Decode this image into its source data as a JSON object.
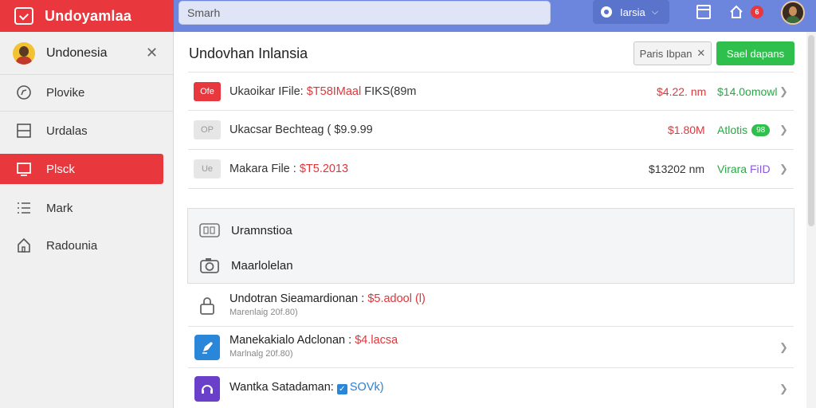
{
  "app": {
    "title": "Undoyamlaa"
  },
  "search": {
    "placeholder": "Smarh"
  },
  "topbar": {
    "user_label": "Iarsia",
    "notification_count": "6"
  },
  "colors": {
    "brand": "#e8383d",
    "topbar": "#6b86dc",
    "success": "#2fbf4c"
  },
  "sidebar": {
    "header": "Undonesia",
    "items": [
      {
        "label": "Plovike",
        "icon": "compass-icon",
        "active": false
      },
      {
        "label": "Urdalas",
        "icon": "layout-icon",
        "active": false
      },
      {
        "label": "Plsck",
        "icon": "monitor-icon",
        "active": true
      },
      {
        "label": "Mark",
        "icon": "list-icon",
        "active": false
      },
      {
        "label": "Radounia",
        "icon": "home-icon",
        "active": false
      }
    ]
  },
  "main": {
    "title": "Undovhan Inlansia",
    "filter_label": "Paris Ibpan",
    "primary_label": "Sael dapans"
  },
  "rows": [
    {
      "tag": "Ofe",
      "label": "Ukaoikar IFile: ",
      "value": "$T58IMaal",
      "rest": " FIKS(89m",
      "amount": "$4.22. nm",
      "extra": "$14.0omowl",
      "extra_pill": ""
    },
    {
      "tag": "OP",
      "label": "Ukacsar Bechteag ( $9.9.99",
      "value": "",
      "rest": "",
      "amount": "$1.80M",
      "extra": "Atlotis",
      "extra_pill": "98"
    },
    {
      "tag": "Ue",
      "label": "Makara File : ",
      "value": "$T5.2013",
      "rest": "",
      "amount": "$13202 nm",
      "extra": "Virara",
      "extra_suffix": " FiID"
    }
  ],
  "panel": [
    {
      "label": "Uramnstioa",
      "icon": "card-icon"
    },
    {
      "label": "Maarlolelan",
      "icon": "camera-icon"
    }
  ],
  "list": [
    {
      "title": "Undotran Sieamardionan : ",
      "value": "$5.adool (l)",
      "sub": "Marenlaig 20f.80)",
      "icon": "lock-icon"
    },
    {
      "title": "Manekakialo Adclonan : ",
      "value": "$4.lacsa",
      "sub": "Marlnalg 20f.80)",
      "icon": "pen-icon"
    },
    {
      "title": "Wantka Satadaman: ",
      "value": "SOVk)",
      "sub": "",
      "icon": "headset-icon"
    }
  ]
}
